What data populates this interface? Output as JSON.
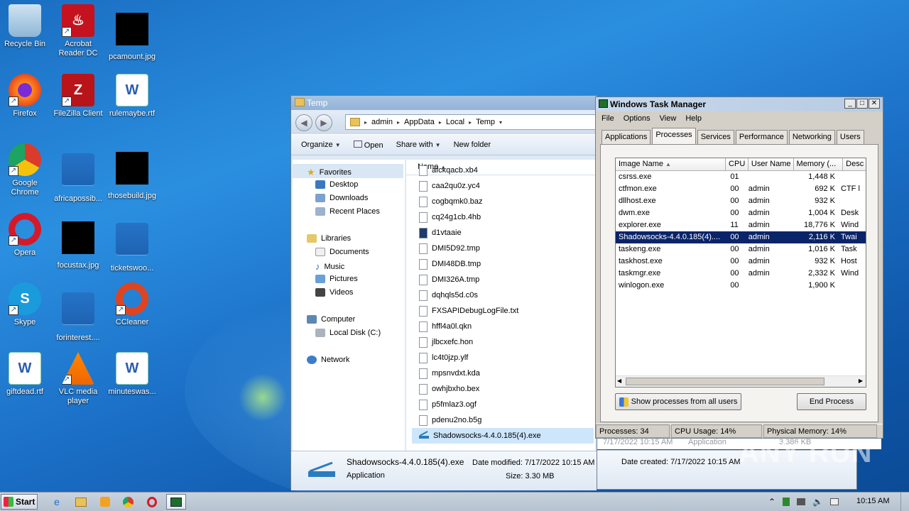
{
  "desktop": {
    "icons": [
      {
        "label": "Recycle Bin",
        "icon": "recycle-bin-icon"
      },
      {
        "label": "Acrobat Reader DC",
        "icon": "acrobat-icon"
      },
      {
        "label": "pcamount.jpg",
        "icon": "image-file-icon"
      },
      {
        "label": "Firefox",
        "icon": "firefox-icon"
      },
      {
        "label": "FileZilla Client",
        "icon": "filezilla-icon"
      },
      {
        "label": "rulemaybe.rtf",
        "icon": "word-doc-icon"
      },
      {
        "label": "Google Chrome",
        "icon": "chrome-icon"
      },
      {
        "label": "africapossib...",
        "icon": "file-icon"
      },
      {
        "label": "thosebuild.jpg",
        "icon": "image-file-icon"
      },
      {
        "label": "Opera",
        "icon": "opera-icon"
      },
      {
        "label": "focustax.jpg",
        "icon": "image-file-icon"
      },
      {
        "label": "ticketswoo...",
        "icon": "file-icon"
      },
      {
        "label": "Skype",
        "icon": "skype-icon"
      },
      {
        "label": "forinterest....",
        "icon": "file-icon"
      },
      {
        "label": "CCleaner",
        "icon": "ccleaner-icon"
      },
      {
        "label": "giftdead.rtf",
        "icon": "word-doc-icon"
      },
      {
        "label": "VLC media player",
        "icon": "vlc-icon"
      },
      {
        "label": "minuteswas...",
        "icon": "word-doc-icon"
      }
    ]
  },
  "explorer": {
    "title": "Temp",
    "breadcrumb": [
      "admin",
      "AppData",
      "Local",
      "Temp"
    ],
    "commands": {
      "organize": "Organize",
      "open": "Open",
      "share": "Share with",
      "new_folder": "New folder"
    },
    "nav": {
      "favorites": "Favorites",
      "desktop": "Desktop",
      "downloads": "Downloads",
      "recent": "Recent Places",
      "libraries": "Libraries",
      "documents": "Documents",
      "music": "Music",
      "pictures": "Pictures",
      "videos": "Videos",
      "computer": "Computer",
      "local_disk": "Local Disk (C:)",
      "network": "Network"
    },
    "column_name": "Name",
    "files": [
      "afckqacb.xb4",
      "caa2qu0z.yc4",
      "cogbqmk0.baz",
      "cq24g1cb.4hb",
      "d1vtaaie",
      "DMI5D92.tmp",
      "DMI48DB.tmp",
      "DMI326A.tmp",
      "dqhqls5d.c0s",
      "FXSAPIDebugLogFile.txt",
      "hffl4a0l.qkn",
      "jlbcxefc.hon",
      "lc4t0jzp.ylf",
      "mpsnvdxt.kda",
      "owhjbxho.bex",
      "p5fmlaz3.ogf",
      "pdenu2no.b5g",
      "Shadowsocks-4.4.0.185(4).exe"
    ],
    "selected_row": {
      "date": "7/17/2022 10:15 AM",
      "type": "Application",
      "size": "3,386 KB"
    },
    "details": {
      "name": "Shadowsocks-4.4.0.185(4).exe",
      "type": "Application",
      "modified_label": "Date modified:",
      "modified": "7/17/2022 10:15 AM",
      "created_label": "Date created:",
      "created": "7/17/2022 10:15 AM",
      "size_label": "Size:",
      "size": "3.30 MB"
    }
  },
  "taskmgr": {
    "title": "Windows Task Manager",
    "menu": [
      "File",
      "Options",
      "View",
      "Help"
    ],
    "tabs": [
      "Applications",
      "Processes",
      "Services",
      "Performance",
      "Networking",
      "Users"
    ],
    "columns": [
      "Image Name",
      "CPU",
      "User Name",
      "Memory (...",
      "Desc"
    ],
    "rows": [
      [
        "csrss.exe",
        "01",
        "",
        "1,448 K",
        ""
      ],
      [
        "ctfmon.exe",
        "00",
        "admin",
        "692 K",
        "CTF l"
      ],
      [
        "dllhost.exe",
        "00",
        "admin",
        "932 K",
        ""
      ],
      [
        "dwm.exe",
        "00",
        "admin",
        "1,004 K",
        "Desk"
      ],
      [
        "explorer.exe",
        "11",
        "admin",
        "18,776 K",
        "Wind"
      ],
      [
        "Shadowsocks-4.4.0.185(4)....",
        "00",
        "admin",
        "2,116 K",
        "Twai"
      ],
      [
        "taskeng.exe",
        "00",
        "admin",
        "1,016 K",
        "Task"
      ],
      [
        "taskhost.exe",
        "00",
        "admin",
        "932 K",
        "Host"
      ],
      [
        "taskmgr.exe",
        "00",
        "admin",
        "2,332 K",
        "Wind"
      ],
      [
        "winlogon.exe",
        "00",
        "",
        "1,900 K",
        ""
      ]
    ],
    "show_all": "Show processes from all users",
    "end_process": "End Process",
    "status": {
      "processes": "Processes: 34",
      "cpu": "CPU Usage: 14%",
      "memory": "Physical Memory: 14%"
    }
  },
  "taskbar": {
    "start": "Start",
    "clock": "10:15 AM"
  },
  "watermark": "ANY RUN"
}
